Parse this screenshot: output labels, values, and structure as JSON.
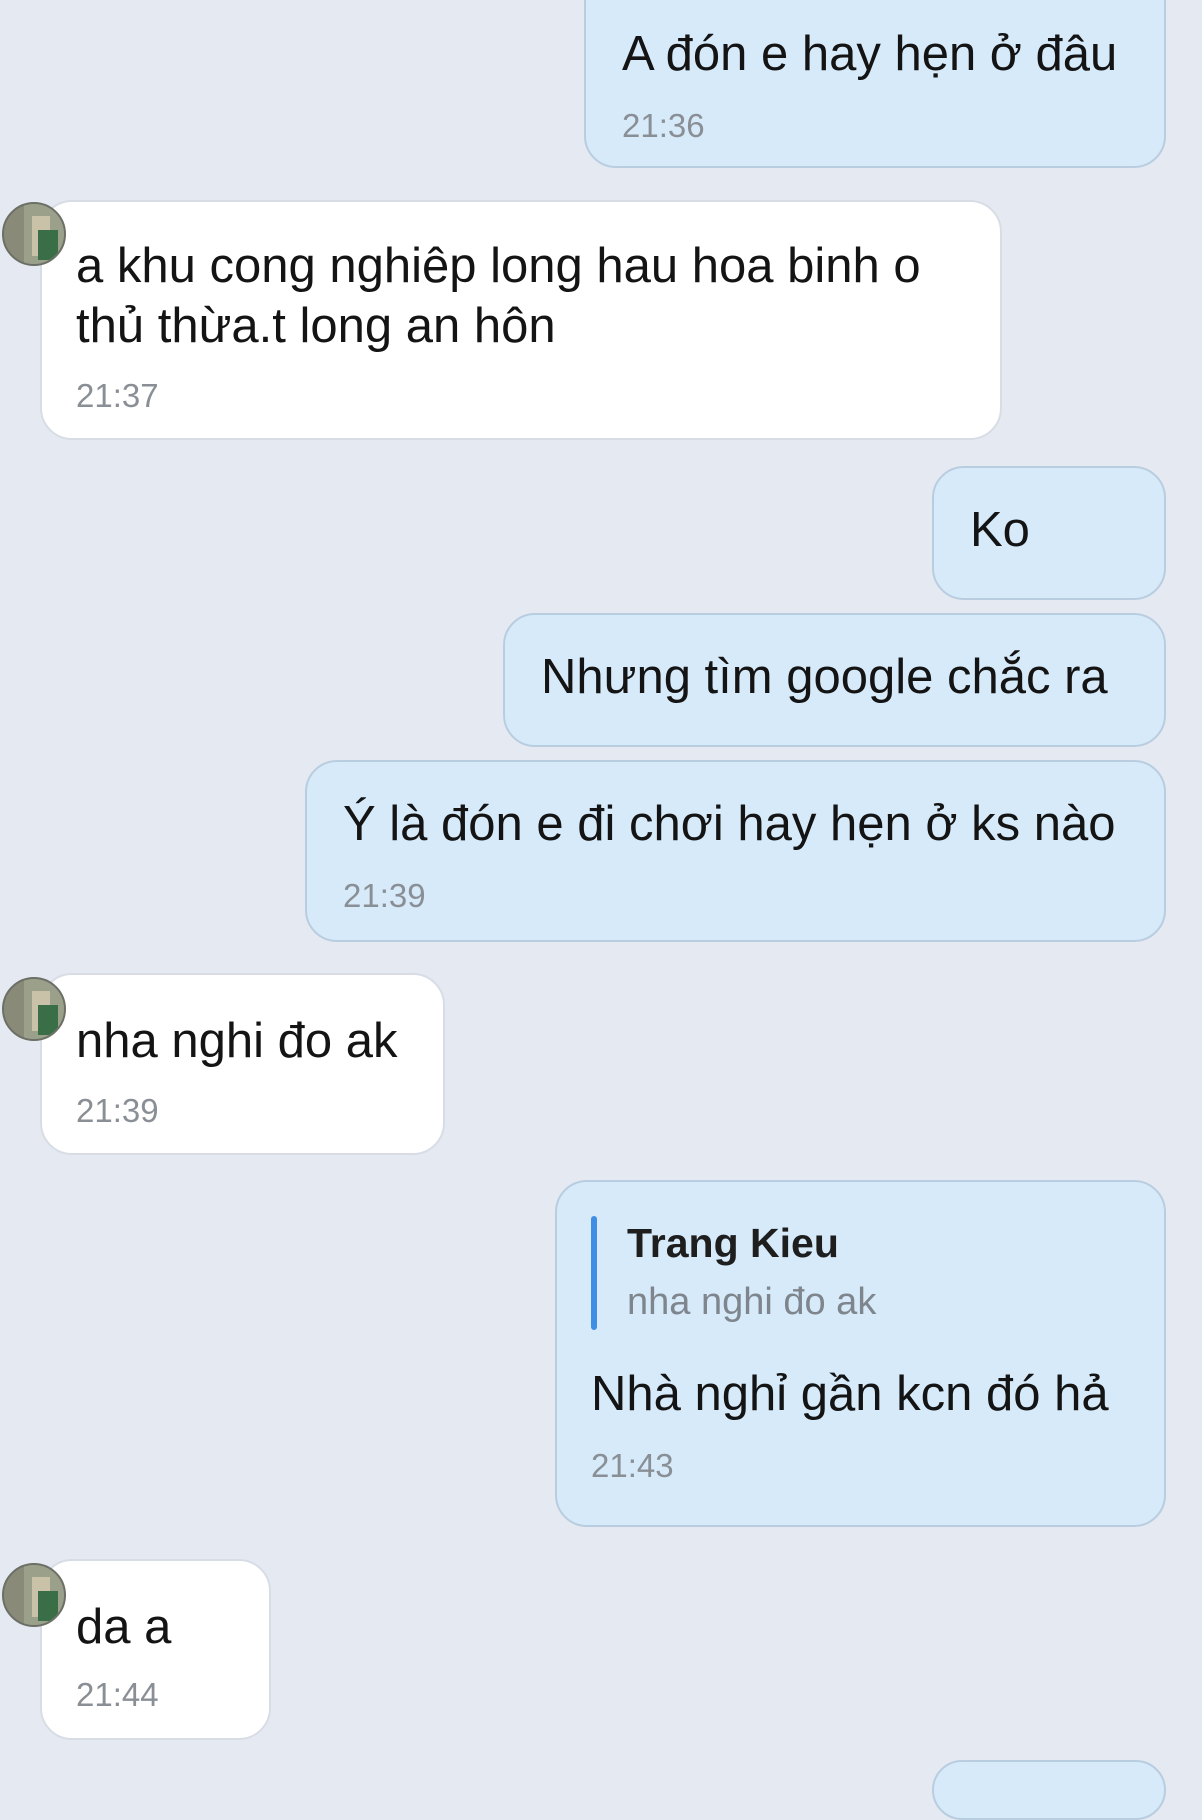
{
  "messages": [
    {
      "direction": "outgoing",
      "text": "A đón e hay hẹn ở đâu",
      "time": "21:36"
    },
    {
      "direction": "incoming",
      "text_lines": [
        "a khu cong nghiêp long hau hoa binh o",
        "thủ thừa.t long an hôn"
      ],
      "time": "21:37",
      "avatar": "contact-avatar"
    },
    {
      "direction": "outgoing",
      "text": "Ko"
    },
    {
      "direction": "outgoing",
      "text": "Nhưng tìm google chắc ra"
    },
    {
      "direction": "outgoing",
      "text": "Ý là đón e đi chơi hay hẹn ở ks nào",
      "time": "21:39"
    },
    {
      "direction": "incoming",
      "text": "nha nghi đo ak",
      "time": "21:39",
      "avatar": "contact-avatar"
    },
    {
      "direction": "outgoing",
      "reply_to": {
        "author": "Trang Kieu",
        "text": "nha nghi đo ak"
      },
      "text": "Nhà nghỉ gần kcn đó hả",
      "time": "21:43"
    },
    {
      "direction": "incoming",
      "text": "da a",
      "time": "21:44",
      "avatar": "contact-avatar"
    }
  ],
  "colors": {
    "background": "#e5e9f1",
    "outgoing_bubble": "#d6eafa",
    "incoming_bubble": "#ffffff",
    "quote_accent": "#3f8ee3",
    "timestamp": "#8a8f96"
  }
}
